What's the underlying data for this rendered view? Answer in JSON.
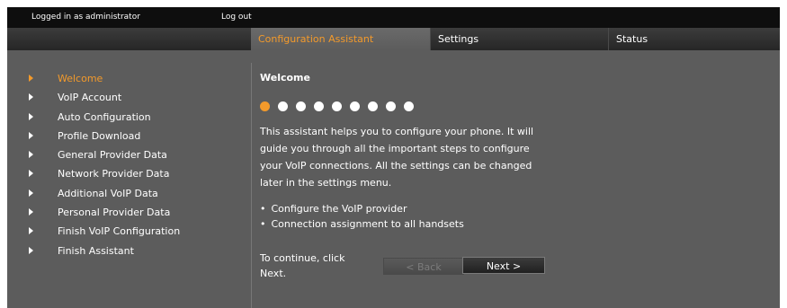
{
  "topbar": {
    "logged_in": "Logged in as administrator",
    "logout": "Log out"
  },
  "tabs": [
    {
      "label": "Configuration Assistant",
      "active": true
    },
    {
      "label": "Settings",
      "active": false
    },
    {
      "label": "Status",
      "active": false
    }
  ],
  "nav": {
    "items": [
      {
        "label": "Welcome",
        "current": true
      },
      {
        "label": "VoIP Account"
      },
      {
        "label": "Auto Configuration"
      },
      {
        "label": "Profile Download"
      },
      {
        "label": "General Provider Data"
      },
      {
        "label": "Network Provider Data"
      },
      {
        "label": "Additional VoIP Data"
      },
      {
        "label": "Personal Provider Data"
      },
      {
        "label": "Finish VoIP Configuration"
      },
      {
        "label": "Finish Assistant"
      }
    ]
  },
  "content": {
    "heading": "Welcome",
    "progress": {
      "current_step": 1,
      "total_steps": 9
    },
    "intro": "This assistant helps you to configure your phone. It will guide you through all the important steps to configure your VoIP connections. All the settings can be changed later in the settings menu.",
    "bullets": [
      "Configure the VoIP provider",
      "Connection assignment to all handsets"
    ],
    "continue_text": "To continue, click Next.",
    "back_label": "< Back",
    "next_label": "Next >"
  },
  "colors": {
    "accent": "#f39a2b",
    "panel": "#5c5c5c",
    "topbar": "#0e0e0e"
  }
}
